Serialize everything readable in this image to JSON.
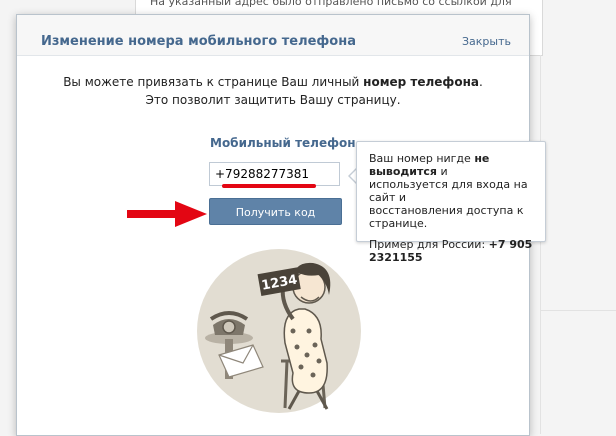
{
  "background": {
    "notice_text": "На указанный адрес было отправлено письмо со ссылкой для"
  },
  "modal": {
    "title": "Изменение номера мобильного телефона",
    "close_label": "Закрыть",
    "intro_line1_pre": "Вы можете привязать к странице Ваш личный ",
    "intro_line1_bold": "номер телефона",
    "intro_line1_post": ".",
    "intro_line2": "Это позволит защитить Вашу страницу.",
    "phone_label": "Мобильный телефон",
    "phone_value": "+79288277381",
    "submit_label": "Получить код"
  },
  "tooltip": {
    "line1_pre": "Ваш номер нигде ",
    "line1_bold": "не выводится",
    "line1_post": " и",
    "line2": "используется для входа на сайт и",
    "line3": "восстановления доступа к странице.",
    "example_label": "Пример для России: ",
    "example_value": "+7 905 2321155"
  },
  "illustration": {
    "card_text": "1234"
  },
  "colors": {
    "header_text": "#45688e",
    "button_bg": "#5f83a8",
    "annotation_red": "#e30613",
    "illustration_circle": "#e2ddd2"
  },
  "icons": {
    "annotation": "red-arrow-right",
    "illustration": "woman-with-phone-and-code-card"
  }
}
